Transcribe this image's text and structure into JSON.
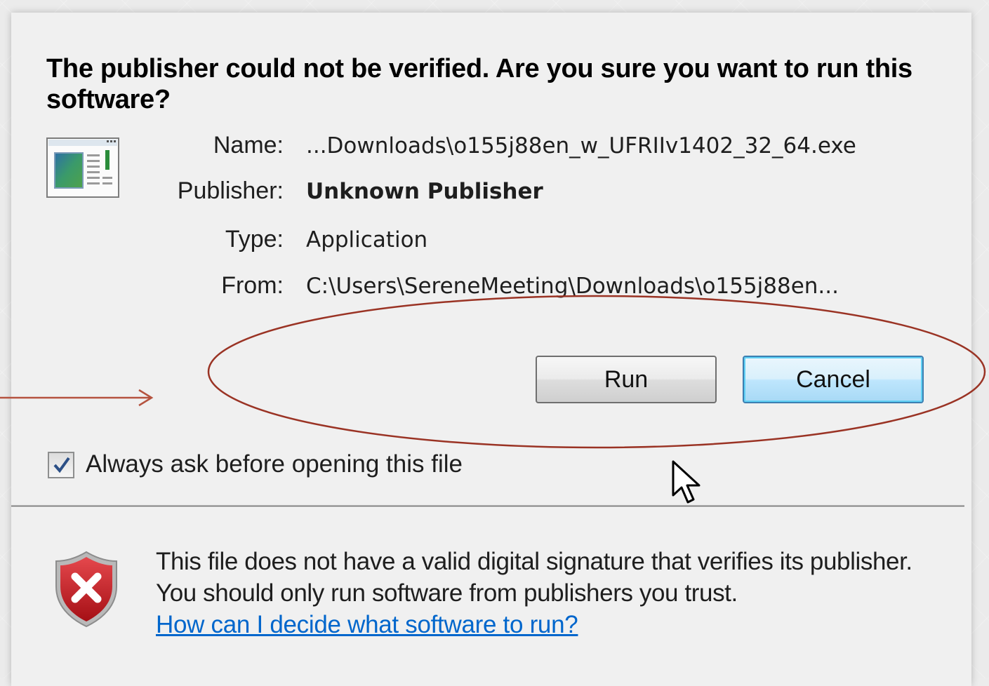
{
  "dialog": {
    "headline": "The publisher could not be verified.  Are you sure you want to run this software?",
    "fields": {
      "name_label": "Name:",
      "name_value": "...Downloads\\o155j88en_w_UFRIIv1402_32_64.exe",
      "publisher_label": "Publisher:",
      "publisher_value": "Unknown Publisher",
      "type_label": "Type:",
      "type_value": "Application",
      "from_label": "From:",
      "from_value": "C:\\Users\\SereneMeeting\\Downloads\\o155j88en..."
    },
    "buttons": {
      "run_label": "Run",
      "cancel_label": "Cancel"
    },
    "checkbox": {
      "label": "Always ask before opening this file",
      "checked": true
    },
    "footer": {
      "warning_text": "This file does not have a valid digital signature that verifies its publisher.  You should only run software from publishers you trust.",
      "help_link": "How can I decide what software to run?"
    }
  },
  "icons": {
    "application": "application-window-icon",
    "shield": "security-shield-error-icon",
    "cursor": "mouse-pointer-icon"
  },
  "colors": {
    "dialog_background": "#f0f0f0",
    "link": "#0066cc",
    "annotation": "#9a3324",
    "cancel_button_highlight": "#bee6fd"
  }
}
